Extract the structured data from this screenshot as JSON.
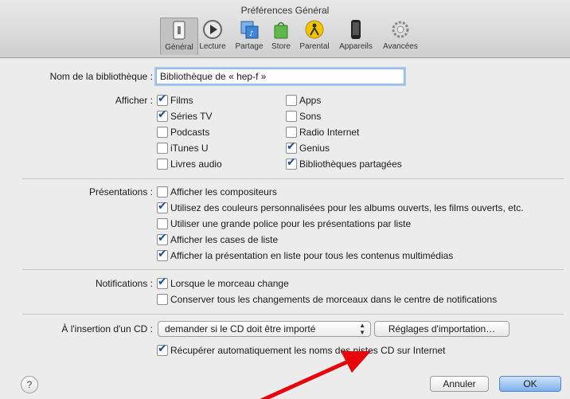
{
  "window": {
    "title": "Préférences Général"
  },
  "toolbar": {
    "items": [
      {
        "label": "Général",
        "icon": "switch-icon"
      },
      {
        "label": "Lecture",
        "icon": "play-icon"
      },
      {
        "label": "Partage",
        "icon": "share-icon"
      },
      {
        "label": "Store",
        "icon": "store-bag-icon"
      },
      {
        "label": "Parental",
        "icon": "parental-icon"
      },
      {
        "label": "Appareils",
        "icon": "iphone-icon"
      },
      {
        "label": "Avancées",
        "icon": "gear-icon"
      }
    ]
  },
  "library": {
    "label": "Nom de la bibliothèque :",
    "value": "Bibliothèque de « hep-f »"
  },
  "afficher": {
    "label": "Afficher :",
    "left": [
      {
        "text": "Films",
        "checked": true
      },
      {
        "text": "Séries TV",
        "checked": true
      },
      {
        "text": "Podcasts",
        "checked": false
      },
      {
        "text": "iTunes U",
        "checked": false
      },
      {
        "text": "Livres audio",
        "checked": false
      }
    ],
    "right": [
      {
        "text": "Apps",
        "checked": false
      },
      {
        "text": "Sons",
        "checked": false
      },
      {
        "text": "Radio Internet",
        "checked": false
      },
      {
        "text": "Genius",
        "checked": true
      },
      {
        "text": "Bibliothèques partagées",
        "checked": true
      }
    ]
  },
  "presentations": {
    "label": "Présentations :",
    "items": [
      {
        "text": "Afficher les compositeurs",
        "checked": false
      },
      {
        "text": "Utilisez des couleurs personnalisées pour les albums ouverts, les films ouverts, etc.",
        "checked": true
      },
      {
        "text": "Utiliser une grande police pour les présentations par liste",
        "checked": false
      },
      {
        "text": "Afficher les cases de liste",
        "checked": true
      },
      {
        "text": "Afficher la présentation en liste pour tous les contenus multimédias",
        "checked": true
      }
    ]
  },
  "notifications": {
    "label": "Notifications :",
    "items": [
      {
        "text": "Lorsque le morceau change",
        "checked": true
      },
      {
        "text": "Conserver tous les changements de morceaux dans le centre de notifications",
        "checked": false
      }
    ]
  },
  "cd": {
    "label": "À l'insertion d'un CD :",
    "select_value": "demander si le CD doit être importé",
    "import_button": "Réglages d'importation…",
    "fetch_names": {
      "text": "Récupérer automatiquement les noms des pistes CD sur Internet",
      "checked": true
    }
  },
  "footer": {
    "help": "?",
    "cancel": "Annuler",
    "ok": "OK"
  },
  "colors": {
    "accent": "#2f6fd6",
    "arrow": "#e8000b"
  }
}
